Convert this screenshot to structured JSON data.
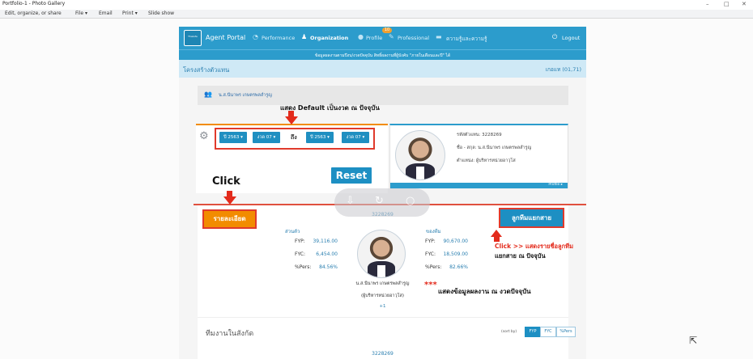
{
  "window": {
    "title": "Portfolio-1 - Photo Gallery",
    "controls": [
      "–",
      "□",
      "✕"
    ]
  },
  "menu": [
    "Edit, organize, or share",
    "File ▾",
    "Email",
    "Print ▾",
    "Slide show"
  ],
  "portal": {
    "logo_text": "ThaiLife",
    "brand": "Agent Portal",
    "nav": [
      "Performance",
      "Organization",
      "Profile",
      "Professional",
      "ความรู้และความรู้"
    ],
    "badge": "10",
    "logout": "Logout",
    "announcement": "ข้อมูลผลงานตามปีงบ/งวดปัจจุบัน สิทธิ์ผลงานที่ผู้บังคับ \"ภายในเดือนและปี\" ได้",
    "crumb_title": "โครงสร้างตัวแทน",
    "crumb_right": "เกอแท (01,71)",
    "agent_name": "น.ส.นีนาพร เกษตรพลสำรูญ",
    "filters": {
      "year_from": "ปี 2563 ▾",
      "period_from": "งวด 07 ▾",
      "to": "ถึง",
      "year_to": "ปี 2563 ▾",
      "period_to": "งวด 07 ▾"
    },
    "reset": "Reset",
    "profile": {
      "code_line": "รหัสตัวแทน: 3228269",
      "name_line": "ชื่อ - สกุล: น.ส.นีนาพร เกษตรพลสำรูญ",
      "position_line": "ตำแหน่ง: ผู้บริหารหน่วยอาวุโส",
      "footer": "Profile ▸"
    },
    "detail_button": "รายละเอียด",
    "downline_button": "ลูกทีมแยกสาย",
    "agent_code": "3228269",
    "col_left": "ส่วนตัว",
    "col_right": "ของทีม",
    "labels": [
      "FYP:",
      "FYC:",
      "%Pers:"
    ],
    "left_values": [
      "39,116.00",
      "6,454.00",
      "84.56%"
    ],
    "right_values": [
      "90,670.00",
      "18,509.00",
      "82.66%"
    ],
    "person_name": "น.ส.นีนาพร เกษตรพลสำรูญ",
    "person_position": "(ผู้บริหารหน่วยอาวุโส)",
    "plus_count": "+1",
    "team_heading": "ทีมงานในสังกัด",
    "sort_label": "(sort by)",
    "sort_options": [
      "FYP",
      "FYC",
      "%Pers"
    ],
    "team_code": "3228269"
  },
  "annotations": {
    "default_note": "แสดง Default เป็นงวด ณ ปัจจุบัน",
    "click": "Click",
    "click_note_1": "Click >> แสดงรายชื่อลูกทีม",
    "click_note_2": "แยกสาย ณ ปัจจุบัน",
    "stars": "***",
    "perf_note": "แสดงข้อมูลผลงาน ณ งวดปัจจุบัน"
  }
}
